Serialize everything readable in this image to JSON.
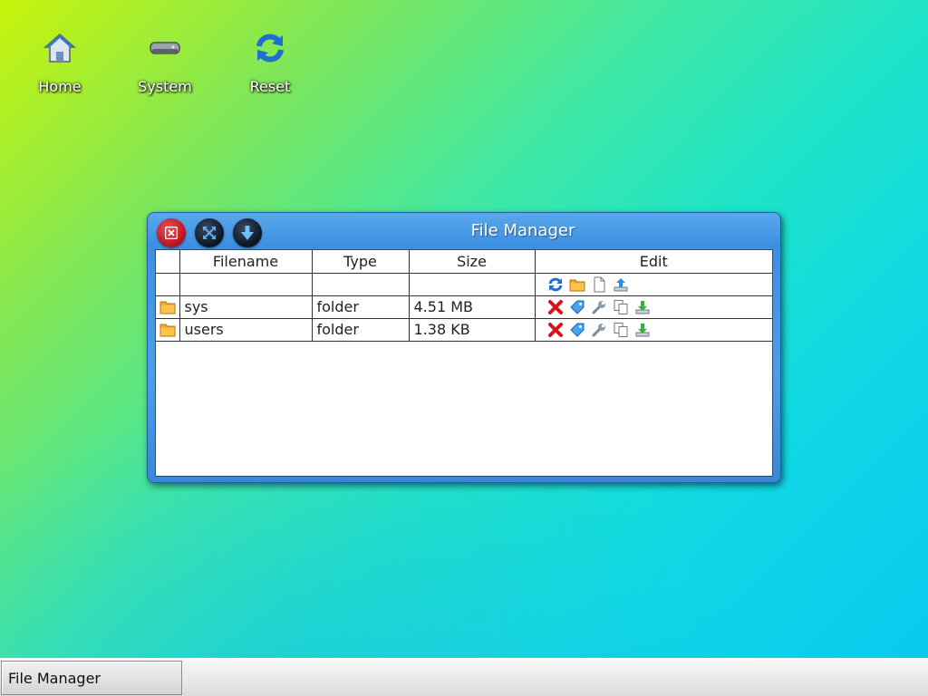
{
  "desktop": {
    "icons": [
      {
        "label": "Home",
        "icon": "home-icon"
      },
      {
        "label": "System",
        "icon": "hard-drive-icon"
      },
      {
        "label": "Reset",
        "icon": "refresh-icon"
      }
    ]
  },
  "window": {
    "title": "File Manager",
    "buttons": [
      "close-icon",
      "maximize-icon",
      "minimize-icon"
    ],
    "table": {
      "columns": [
        "Filename",
        "Type",
        "Size",
        "Edit"
      ],
      "toolbar_icons": [
        "refresh-icon",
        "new-folder-icon",
        "new-file-icon",
        "upload-icon"
      ],
      "rows": [
        {
          "name": "sys",
          "type": "folder",
          "size": "4.51 MB"
        },
        {
          "name": "users",
          "type": "folder",
          "size": "1.38 KB"
        }
      ],
      "row_actions": [
        "delete-icon",
        "rename-tag-icon",
        "properties-wrench-icon",
        "copy-icon",
        "download-icon"
      ]
    }
  },
  "taskbar": {
    "tasks": [
      {
        "label": "File Manager"
      }
    ]
  }
}
